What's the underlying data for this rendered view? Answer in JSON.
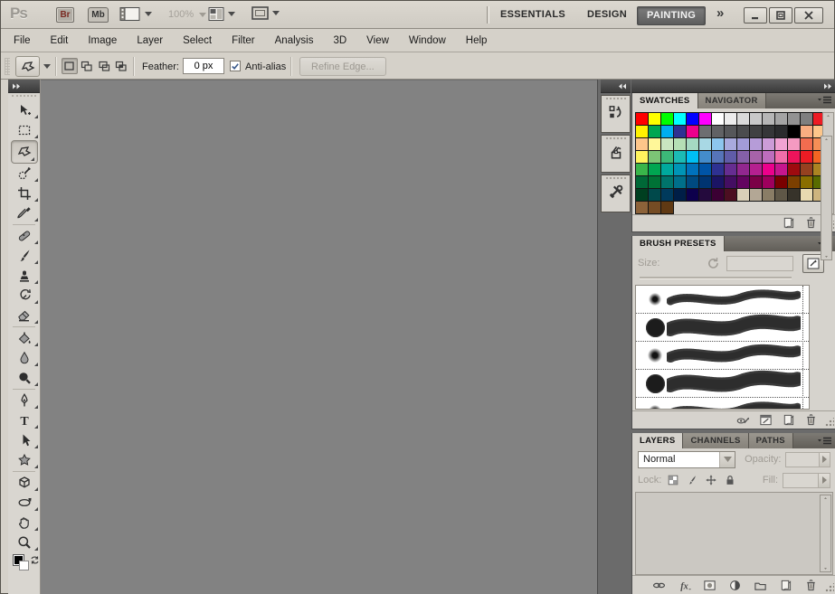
{
  "titlebar": {
    "logo": "Ps",
    "bridge_label": "Br",
    "minibridge_label": "Mb",
    "zoom_level": "100%",
    "workspaces": [
      "ESSENTIALS",
      "DESIGN",
      "PAINTING"
    ],
    "active_workspace": "PAINTING",
    "overflow_chevrons": "»"
  },
  "menubar": {
    "items": [
      "File",
      "Edit",
      "Image",
      "Layer",
      "Select",
      "Filter",
      "Analysis",
      "3D",
      "View",
      "Window",
      "Help"
    ]
  },
  "options_bar": {
    "tool": "polygonal-lasso",
    "mode_buttons": [
      "new-selection",
      "add-to-selection",
      "subtract-from-selection",
      "intersect-with-selection"
    ],
    "pressed_mode": "new-selection",
    "feather_label": "Feather:",
    "feather_value": "0 px",
    "antialias_label": "Anti-alias",
    "antialias_checked": true,
    "refine_edge_label": "Refine Edge...",
    "refine_edge_enabled": false
  },
  "toolbox": {
    "selected_tool": "polygonal-lasso",
    "tools": [
      "move",
      "rectangular-marquee",
      "polygonal-lasso",
      "quick-selection",
      "crop",
      "eyedropper",
      "spot-healing-brush",
      "brush",
      "clone-stamp",
      "history-brush",
      "eraser",
      "paint-bucket",
      "blur",
      "dodge",
      "pen",
      "type",
      "path-selection",
      "custom-shape",
      "3d-object-rotate",
      "3d-camera-rotate",
      "hand",
      "zoom"
    ],
    "group_breaks_after": [
      "eyedropper",
      "eraser",
      "dodge",
      "custom-shape"
    ],
    "foreground_color": "#000000",
    "background_color": "#ffffff"
  },
  "dock_strip": {
    "icons": [
      "history",
      "brush-panel",
      "tool-presets"
    ]
  },
  "swatches_panel": {
    "tabs": [
      "SWATCHES",
      "NAVIGATOR"
    ],
    "active_tab": "SWATCHES",
    "columns": 15,
    "colors": [
      "#ff0000",
      "#ffff00",
      "#00ff00",
      "#00ffff",
      "#0000ff",
      "#ff00ff",
      "#ffffff",
      "#ececec",
      "#dadada",
      "#c8c8c8",
      "#b6b6b6",
      "#a4a4a4",
      "#929292",
      "#7f7f7f",
      "#ed1c24",
      "#fff200",
      "#00a651",
      "#00aeef",
      "#2e3192",
      "#ec008c",
      "#6d6e71",
      "#616265",
      "#56575a",
      "#4b4c4e",
      "#404142",
      "#353638",
      "#2a2b2d",
      "#000000",
      "#f9ad81",
      "#fdc68a",
      "#fdc68a",
      "#fff799",
      "#c9e5c0",
      "#b5dfb5",
      "#a5d9c2",
      "#a8d8e4",
      "#8dc6ee",
      "#a9aade",
      "#a29cd8",
      "#b69cd8",
      "#cc9cd8",
      "#f0a3d3",
      "#f49ac1",
      "#f26c4f",
      "#f68e56",
      "#fff45e",
      "#7cc576",
      "#3cb878",
      "#1cbbb4",
      "#00bff3",
      "#448ccb",
      "#5674b9",
      "#605ca8",
      "#8560a8",
      "#a763a9",
      "#bd6dbd",
      "#f06eaa",
      "#ed145b",
      "#ed1c24",
      "#f26522",
      "#39b54a",
      "#00a651",
      "#00a99d",
      "#0095b6",
      "#0072bc",
      "#0054a6",
      "#2e3192",
      "#662d91",
      "#92278f",
      "#b5208f",
      "#ec008c",
      "#c6168d",
      "#9e0b0f",
      "#964120",
      "#ab8422",
      "#006837",
      "#007236",
      "#00746b",
      "#006f8a",
      "#004a80",
      "#003471",
      "#1b1464",
      "#440e62",
      "#630460",
      "#7b0046",
      "#9e005d",
      "#790000",
      "#7b3f00",
      "#8a6e00",
      "#586b00",
      "#003f20",
      "#00494b",
      "#003a5c",
      "#001e47",
      "#0d004c",
      "#240a3d",
      "#3b0033",
      "#4c0e21",
      "#d9cfb8",
      "#b3a795",
      "#8a7d66",
      "#5f5747",
      "#37332a",
      "#e8d9b0",
      "#cdb47e",
      "#8c6239",
      "#754c24",
      "#603913"
    ],
    "footer_icons": [
      "new-swatch",
      "delete-swatch"
    ]
  },
  "brush_panel": {
    "title": "BRUSH PRESETS",
    "size_label": "Size:",
    "size_value": "",
    "presets": [
      {
        "type": "soft",
        "dot": 10,
        "stroke": 9
      },
      {
        "type": "hard",
        "dot": 21,
        "stroke": 16
      },
      {
        "type": "soft",
        "dot": 12,
        "stroke": 12
      },
      {
        "type": "hard",
        "dot": 21,
        "stroke": 16
      },
      {
        "type": "soft",
        "dot": 10,
        "stroke": 9
      }
    ],
    "footer_icons": [
      "preview-stroke",
      "open-brush-panel",
      "new-brush",
      "delete-brush"
    ]
  },
  "layers_panel": {
    "tabs": [
      "LAYERS",
      "CHANNELS",
      "PATHS"
    ],
    "active_tab": "LAYERS",
    "blend_mode": "Normal",
    "opacity_label": "Opacity:",
    "opacity_value": "",
    "lock_label": "Lock:",
    "lock_icons": [
      "lock-transparency",
      "lock-paint",
      "lock-position",
      "lock-all"
    ],
    "fill_label": "Fill:",
    "fill_value": "",
    "footer_icons": [
      "link-layers",
      "layer-styles",
      "add-layer-mask",
      "new-adjustment-layer",
      "new-group",
      "new-layer",
      "delete-layer"
    ]
  },
  "colors": {
    "canvas": "#828282",
    "dock_background": "#6b6b6b",
    "chrome": "#d5d1c9",
    "panel": "#d6d3cd",
    "workspace_active_bg": "#6e6e6e"
  }
}
